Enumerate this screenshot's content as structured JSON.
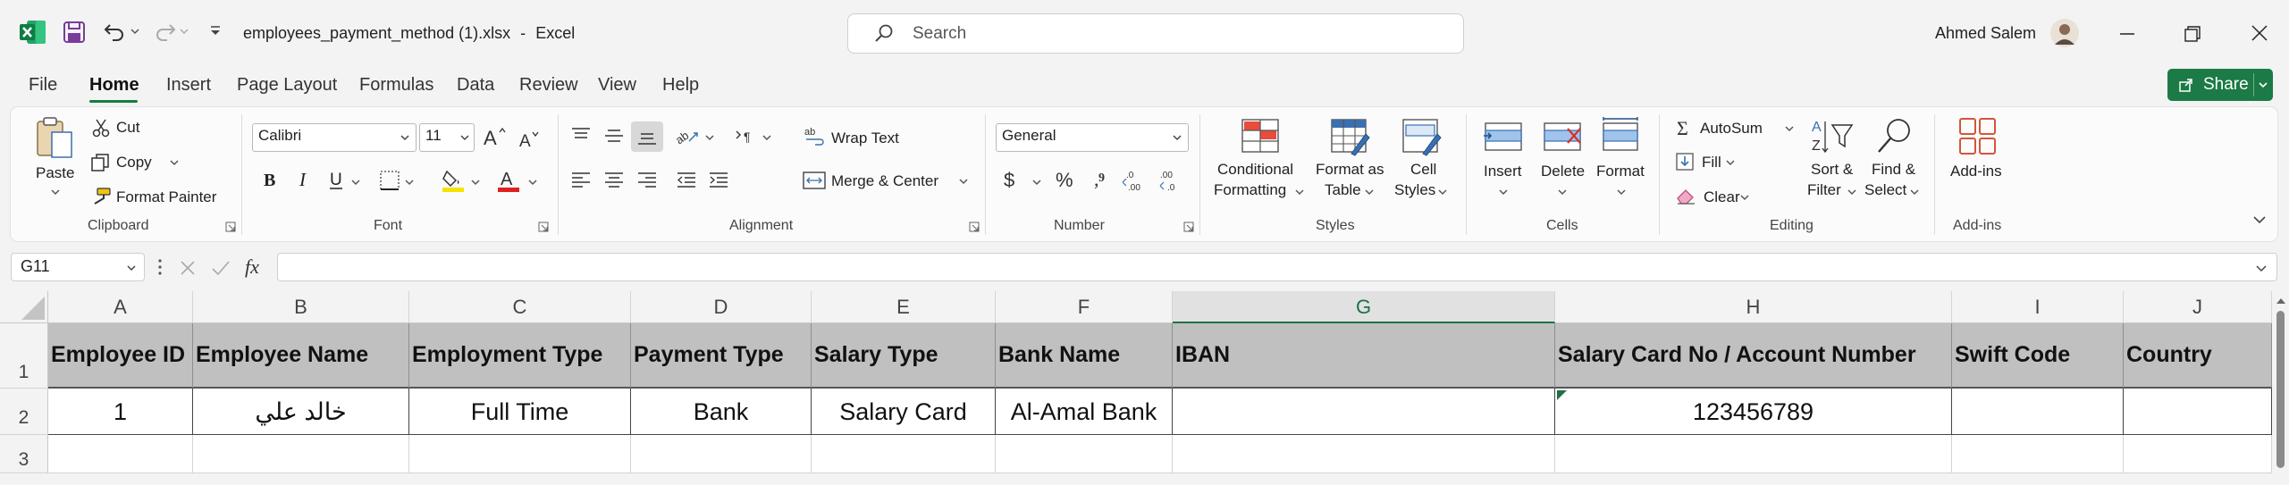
{
  "titlebar": {
    "filename": "employees_payment_method (1).xlsx",
    "separator": "-",
    "app_name": "Excel",
    "search_placeholder": "Search",
    "user_name": "Ahmed Salem"
  },
  "menu": {
    "items": [
      "File",
      "Home",
      "Insert",
      "Page Layout",
      "Formulas",
      "Data",
      "Review",
      "View",
      "Help"
    ],
    "share_label": "Share"
  },
  "ribbon": {
    "clipboard": {
      "paste": "Paste",
      "cut": "Cut",
      "copy": "Copy",
      "format_painter": "Format Painter",
      "group": "Clipboard"
    },
    "font": {
      "name": "Calibri",
      "size": "11",
      "group": "Font"
    },
    "alignment": {
      "wrap_text": "Wrap Text",
      "merge_center": "Merge & Center",
      "group": "Alignment"
    },
    "number": {
      "format": "General",
      "group": "Number"
    },
    "styles": {
      "conditional_1": "Conditional",
      "conditional_2": "Formatting",
      "format_table_1": "Format as",
      "format_table_2": "Table",
      "cell_styles_1": "Cell",
      "cell_styles_2": "Styles",
      "group": "Styles"
    },
    "cells": {
      "insert": "Insert",
      "delete": "Delete",
      "format": "Format",
      "group": "Cells"
    },
    "editing": {
      "autosum": "AutoSum",
      "fill": "Fill",
      "clear": "Clear",
      "sort_1": "Sort &",
      "sort_2": "Filter",
      "find_1": "Find &",
      "find_2": "Select",
      "group": "Editing"
    },
    "addins": {
      "addins": "Add-ins",
      "group": "Add-ins"
    }
  },
  "formula_bar": {
    "name_box": "G11",
    "fx": "fx",
    "value": ""
  },
  "sheet": {
    "columns": [
      "A",
      "B",
      "C",
      "D",
      "E",
      "F",
      "G",
      "H",
      "I",
      "J"
    ],
    "selected_column": "G",
    "rows": [
      "1",
      "2",
      "3"
    ],
    "header_row": [
      "Employee ID",
      "Employee Name",
      "Employment Type",
      "Payment Type",
      "Salary Type",
      "Bank Name",
      "IBAN",
      "Salary Card No / Account Number",
      "Swift Code",
      "Country"
    ],
    "data_row": [
      "1",
      "خالد علي",
      "Full Time",
      "Bank",
      "Salary Card",
      "Al-Amal Bank",
      "",
      "123456789",
      "",
      ""
    ]
  },
  "colors": {
    "accent": "#1b7a45",
    "header_fill": "#c0c0c0",
    "selected_header_text": "#1e7145"
  }
}
